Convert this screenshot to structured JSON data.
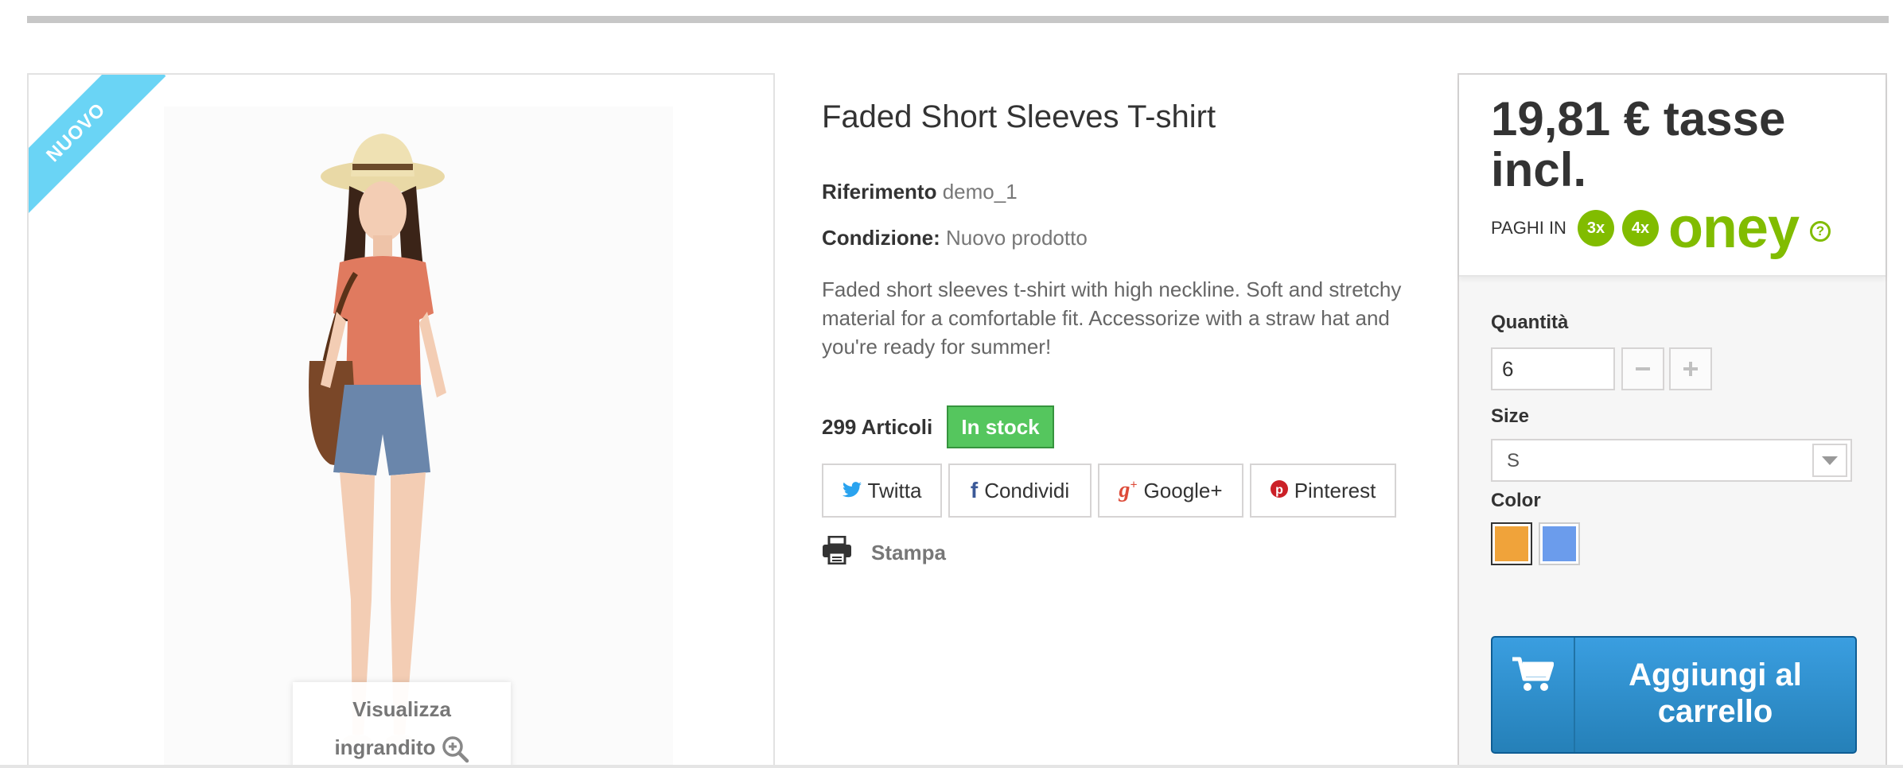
{
  "product": {
    "badge": "NUOVO",
    "title": "Faded Short Sleeves T-shirt",
    "reference_label": "Riferimento",
    "reference_value": "demo_1",
    "condition_label": "Condizione:",
    "condition_value": "Nuovo prodotto",
    "description": "Faded short sleeves t-shirt with high neckline. Soft and stretchy material for a comfortable fit. Accessorize with a straw hat and you're ready for summer!",
    "stock_count": "299 Articoli",
    "stock_status": "In stock"
  },
  "image": {
    "zoom_line1": "Visualizza",
    "zoom_line2": "ingrandito"
  },
  "social": {
    "twitter": "Twitta",
    "facebook": "Condividi",
    "google": "Google+",
    "pinterest": "Pinterest"
  },
  "print_label": "Stampa",
  "buy_box": {
    "price": "19,81 € tasse incl.",
    "paghi_label": "PAGHI IN",
    "installment_3x": "3x",
    "installment_4x": "4x",
    "oney_logo": "oney",
    "quantity_label": "Quantità",
    "quantity_value": "6",
    "size_label": "Size",
    "size_value": "S",
    "color_label": "Color",
    "colors": [
      "#f0a33a",
      "#6b9cec"
    ],
    "cart_button": "Aggiungi al carrello"
  },
  "colors": {
    "accent_blue": "#2f92cf",
    "stock_green": "#55c65e",
    "oney_green": "#81bc00",
    "ribbon_blue": "#6ad4f5"
  }
}
